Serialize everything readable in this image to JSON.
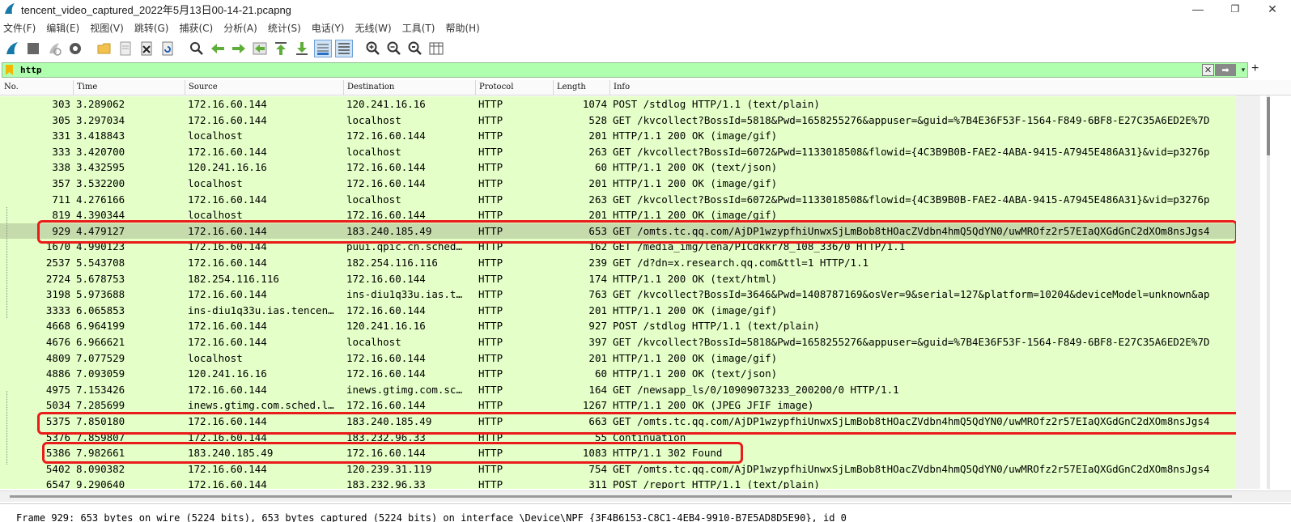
{
  "window": {
    "title": "tencent_video_captured_2022年5月13日00-14-21.pcapng",
    "minimize": "—",
    "maximize": "❐",
    "close": "✕"
  },
  "menu": [
    "文件(F)",
    "编辑(E)",
    "视图(V)",
    "跳转(G)",
    "捕获(C)",
    "分析(A)",
    "统计(S)",
    "电话(Y)",
    "无线(W)",
    "工具(T)",
    "帮助(H)"
  ],
  "filter": {
    "value": "http",
    "apply_arrow": "➡",
    "clear": "✕",
    "dropdown": "▾",
    "add": "+"
  },
  "columns": [
    "No.",
    "Time",
    "Source",
    "Destination",
    "Protocol",
    "Length",
    "Info"
  ],
  "sort_indicator": "^",
  "packets": [
    {
      "no": "303",
      "time": "3.289062",
      "src": "172.16.60.144",
      "dst": "120.241.16.16",
      "proto": "HTTP",
      "len": "1074",
      "info": "POST /stdlog HTTP/1.1  (text/plain)"
    },
    {
      "no": "305",
      "time": "3.297034",
      "src": "172.16.60.144",
      "dst": "localhost",
      "proto": "HTTP",
      "len": "528",
      "info": "GET /kvcollect?BossId=5818&Pwd=1658255276&appuser=&guid=%7B4E36F53F-1564-F849-6BF8-E27C35A6ED2E%7D"
    },
    {
      "no": "331",
      "time": "3.418843",
      "src": "localhost",
      "dst": "172.16.60.144",
      "proto": "HTTP",
      "len": "201",
      "info": "HTTP/1.1 200 OK  (image/gif)"
    },
    {
      "no": "333",
      "time": "3.420700",
      "src": "172.16.60.144",
      "dst": "localhost",
      "proto": "HTTP",
      "len": "263",
      "info": "GET /kvcollect?BossId=6072&Pwd=1133018508&flowid={4C3B9B0B-FAE2-4ABA-9415-A7945E486A31}&vid=p3276p"
    },
    {
      "no": "338",
      "time": "3.432595",
      "src": "120.241.16.16",
      "dst": "172.16.60.144",
      "proto": "HTTP",
      "len": "60",
      "info": "HTTP/1.1 200 OK  (text/json)"
    },
    {
      "no": "357",
      "time": "3.532200",
      "src": "localhost",
      "dst": "172.16.60.144",
      "proto": "HTTP",
      "len": "201",
      "info": "HTTP/1.1 200 OK  (image/gif)"
    },
    {
      "no": "711",
      "time": "4.276166",
      "src": "172.16.60.144",
      "dst": "localhost",
      "proto": "HTTP",
      "len": "263",
      "info": "GET /kvcollect?BossId=6072&Pwd=1133018508&flowid={4C3B9B0B-FAE2-4ABA-9415-A7945E486A31}&vid=p3276p"
    },
    {
      "no": "819",
      "time": "4.390344",
      "src": "localhost",
      "dst": "172.16.60.144",
      "proto": "HTTP",
      "len": "201",
      "info": "HTTP/1.1 200 OK  (image/gif)"
    },
    {
      "no": "929",
      "time": "4.479127",
      "src": "172.16.60.144",
      "dst": "183.240.185.49",
      "proto": "HTTP",
      "len": "653",
      "info": "GET /omts.tc.qq.com/AjDP1wzypfhiUnwxSjLmBob8tHOacZVdbn4hmQ5QdYN0/uwMROfz2r57EIaQXGdGnC2dXOm8nsJgs4"
    },
    {
      "no": "1670",
      "time": "4.990123",
      "src": "172.16.60.144",
      "dst": "puui.qpic.cn.sched…",
      "proto": "HTTP",
      "len": "162",
      "info": "GET /media_img/lena/PICdkkr78_108_336/0 HTTP/1.1"
    },
    {
      "no": "2537",
      "time": "5.543708",
      "src": "172.16.60.144",
      "dst": "182.254.116.116",
      "proto": "HTTP",
      "len": "239",
      "info": "GET /d?dn=x.research.qq.com&ttl=1 HTTP/1.1"
    },
    {
      "no": "2724",
      "time": "5.678753",
      "src": "182.254.116.116",
      "dst": "172.16.60.144",
      "proto": "HTTP",
      "len": "174",
      "info": "HTTP/1.1 200 OK  (text/html)"
    },
    {
      "no": "3198",
      "time": "5.973688",
      "src": "172.16.60.144",
      "dst": "ins-diu1q33u.ias.t…",
      "proto": "HTTP",
      "len": "763",
      "info": "GET /kvcollect?BossId=3646&Pwd=1408787169&osVer=9&serial=127&platform=10204&deviceModel=unknown&ap"
    },
    {
      "no": "3333",
      "time": "6.065853",
      "src": "ins-diu1q33u.ias.tencen…",
      "dst": "172.16.60.144",
      "proto": "HTTP",
      "len": "201",
      "info": "HTTP/1.1 200 OK  (image/gif)"
    },
    {
      "no": "4668",
      "time": "6.964199",
      "src": "172.16.60.144",
      "dst": "120.241.16.16",
      "proto": "HTTP",
      "len": "927",
      "info": "POST /stdlog HTTP/1.1  (text/plain)"
    },
    {
      "no": "4676",
      "time": "6.966621",
      "src": "172.16.60.144",
      "dst": "localhost",
      "proto": "HTTP",
      "len": "397",
      "info": "GET /kvcollect?BossId=5818&Pwd=1658255276&appuser=&guid=%7B4E36F53F-1564-F849-6BF8-E27C35A6ED2E%7D"
    },
    {
      "no": "4809",
      "time": "7.077529",
      "src": "localhost",
      "dst": "172.16.60.144",
      "proto": "HTTP",
      "len": "201",
      "info": "HTTP/1.1 200 OK  (image/gif)"
    },
    {
      "no": "4886",
      "time": "7.093059",
      "src": "120.241.16.16",
      "dst": "172.16.60.144",
      "proto": "HTTP",
      "len": "60",
      "info": "HTTP/1.1 200 OK  (text/json)"
    },
    {
      "no": "4975",
      "time": "7.153426",
      "src": "172.16.60.144",
      "dst": "inews.gtimg.com.sc…",
      "proto": "HTTP",
      "len": "164",
      "info": "GET /newsapp_ls/0/10909073233_200200/0 HTTP/1.1"
    },
    {
      "no": "5034",
      "time": "7.285699",
      "src": "inews.gtimg.com.sched.l…",
      "dst": "172.16.60.144",
      "proto": "HTTP",
      "len": "1267",
      "info": "HTTP/1.1 200 OK  (JPEG JFIF image)"
    },
    {
      "no": "5375",
      "time": "7.850180",
      "src": "172.16.60.144",
      "dst": "183.240.185.49",
      "proto": "HTTP",
      "len": "663",
      "info": "GET /omts.tc.qq.com/AjDP1wzypfhiUnwxSjLmBob8tHOacZVdbn4hmQ5QdYN0/uwMROfz2r57EIaQXGdGnC2dXOm8nsJgs4"
    },
    {
      "no": "5376",
      "time": "7.859807",
      "src": "172.16.60.144",
      "dst": "183.232.96.33",
      "proto": "HTTP",
      "len": "55",
      "info": "Continuation"
    },
    {
      "no": "5386",
      "time": "7.982661",
      "src": "183.240.185.49",
      "dst": "172.16.60.144",
      "proto": "HTTP",
      "len": "1083",
      "info": "HTTP/1.1 302 Found"
    },
    {
      "no": "5402",
      "time": "8.090382",
      "src": "172.16.60.144",
      "dst": "120.239.31.119",
      "proto": "HTTP",
      "len": "754",
      "info": "GET /omts.tc.qq.com/AjDP1wzypfhiUnwxSjLmBob8tHOacZVdbn4hmQ5QdYN0/uwMROfz2r57EIaQXGdGnC2dXOm8nsJgs4"
    },
    {
      "no": "6547",
      "time": "9.290640",
      "src": "172.16.60.144",
      "dst": "183.232.96.33",
      "proto": "HTTP",
      "len": "311",
      "info": "POST /report HTTP/1.1  (text/plain)"
    }
  ],
  "selected_index": 8,
  "highlight_color": "#ea1b1b",
  "row_color": "#e4ffc7",
  "selected_row_color": "#c6dbab",
  "filter_bg": "#afffaf",
  "detail_line": "Frame 929: 653 bytes on wire (5224 bits), 653 bytes captured (5224 bits) on interface \\Device\\NPF_{3F4B6153-C8C1-4EB4-9910-B7E5AD8D5E90}, id 0"
}
